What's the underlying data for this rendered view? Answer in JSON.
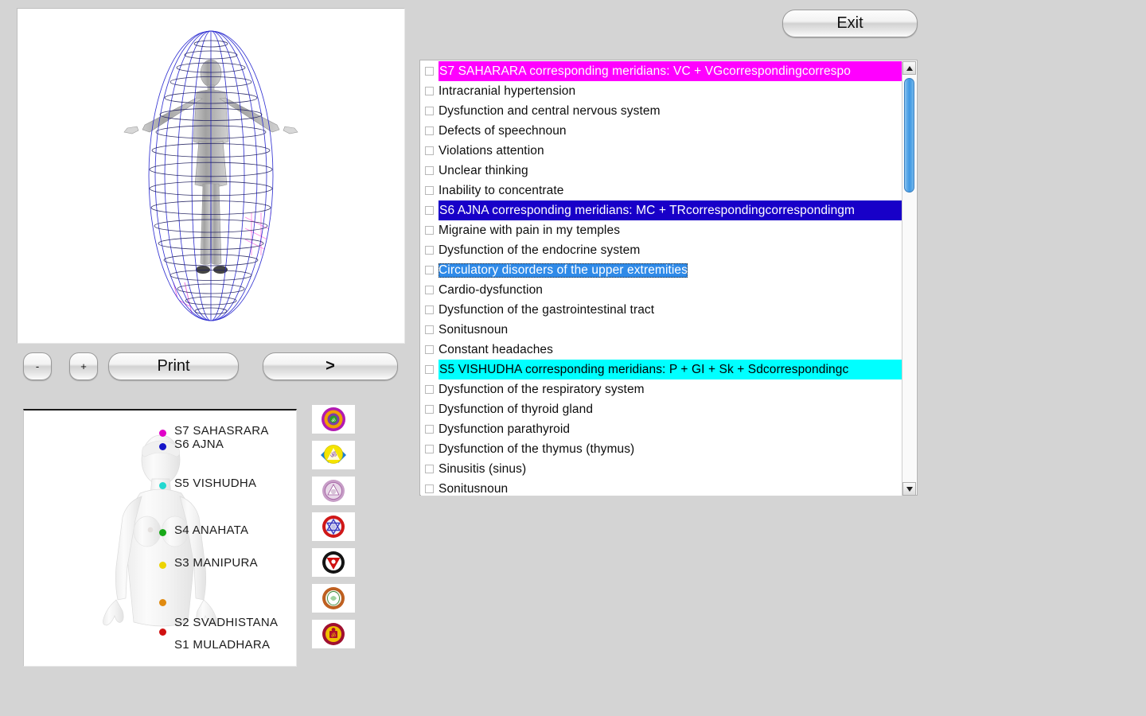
{
  "buttons": {
    "exit": "Exit",
    "minus": "-",
    "plus": "+",
    "print": "Print",
    "next": ">"
  },
  "aura_panel": {
    "title": "aura-wireframe-visualization",
    "mesh_color": "#2a2ad0",
    "body_color": "#a8a8a8",
    "accent_color": "#ff3fd0"
  },
  "legend": {
    "title": "chakra-body-legend",
    "items": [
      {
        "label": "S7 SAHASRARA",
        "color": "#e000c8"
      },
      {
        "label": "S6 AJNA",
        "color": "#1414c8"
      },
      {
        "label": "S5 VISHUDHA",
        "color": "#22d8d0"
      },
      {
        "label": "S4 ANAHATA",
        "color": "#18a818"
      },
      {
        "label": "S3 MANIPURA",
        "color": "#ecd400"
      },
      {
        "label": "S2 SVADHISTANA",
        "color": "#e08a10"
      },
      {
        "label": "S1 MULADHARA",
        "color": "#d01010"
      }
    ]
  },
  "chakra_icons": [
    {
      "name": "sahasrara-icon",
      "outer": "#b21ab2",
      "mid": "#f0a000",
      "inner": "#2aa02a"
    },
    {
      "name": "ajna-icon",
      "outer": "#1a7fd4",
      "mid": "#f5e400",
      "inner": "#8e44ad"
    },
    {
      "name": "vishudha-icon",
      "outer": "#b07fb0",
      "mid": "#e8d8e8",
      "inner": "#a05aa0"
    },
    {
      "name": "anahata-icon",
      "outer": "#d01818",
      "mid": "#ffffff",
      "inner": "#3a3ac0"
    },
    {
      "name": "manipura-icon",
      "outer": "#111111",
      "mid": "#ffffff",
      "inner": "#d01010"
    },
    {
      "name": "svadhistana-icon",
      "outer": "#c06020",
      "mid": "#f0ede0",
      "inner": "#3a8a3a"
    },
    {
      "name": "muladhara-icon",
      "outer": "#a01030",
      "mid": "#f0c000",
      "inner": "#b0102a"
    }
  ],
  "symptom_list": {
    "name": "symptom-checklist",
    "rows": [
      {
        "text": "S7 SAHARARA corresponding meridians: VC + VGcorrespondingcorrespo",
        "style": "hdr-magenta",
        "checked": false
      },
      {
        "text": "Intracranial hypertension",
        "style": "normal",
        "checked": false
      },
      {
        "text": "Dysfunction and central nervous system",
        "style": "normal",
        "checked": false
      },
      {
        "text": "Defects of speechnoun",
        "style": "normal",
        "checked": false
      },
      {
        "text": "Violations attention",
        "style": "normal",
        "checked": false
      },
      {
        "text": "Unclear thinking",
        "style": "normal",
        "checked": false
      },
      {
        "text": "Inability to concentrate",
        "style": "normal",
        "checked": false
      },
      {
        "text": "S6 AJNA corresponding meridians: MC + TRcorrespondingcorrespondingm",
        "style": "hdr-blue",
        "checked": false
      },
      {
        "text": "Migraine with pain in my temples",
        "style": "normal",
        "checked": false
      },
      {
        "text": "Dysfunction of the endocrine system",
        "style": "normal",
        "checked": false
      },
      {
        "text": "Circulatory disorders of the upper extremities",
        "style": "selected",
        "checked": false
      },
      {
        "text": "Cardio-dysfunction",
        "style": "normal",
        "checked": false
      },
      {
        "text": "Dysfunction of the gastrointestinal tract",
        "style": "normal",
        "checked": false
      },
      {
        "text": "Sonitusnoun",
        "style": "normal",
        "checked": false
      },
      {
        "text": "Constant headaches",
        "style": "normal",
        "checked": false
      },
      {
        "text": "S5 VISHUDHA corresponding meridians: P + GI + Sk + Sdcorrespondingc",
        "style": "hdr-cyan",
        "checked": false
      },
      {
        "text": "Dysfunction of the respiratory system",
        "style": "normal",
        "checked": false
      },
      {
        "text": "Dysfunction of thyroid gland",
        "style": "normal",
        "checked": false
      },
      {
        "text": "Dysfunction parathyroid",
        "style": "normal",
        "checked": false
      },
      {
        "text": "Dysfunction of the thymus (thymus)",
        "style": "normal",
        "checked": false
      },
      {
        "text": "Sinusitis (sinus)",
        "style": "normal",
        "checked": false
      },
      {
        "text": "Sonitusnoun",
        "style": "normal",
        "checked": false
      }
    ]
  },
  "scrollbar": {
    "up_arrow": "▲",
    "down_arrow": "▼"
  }
}
